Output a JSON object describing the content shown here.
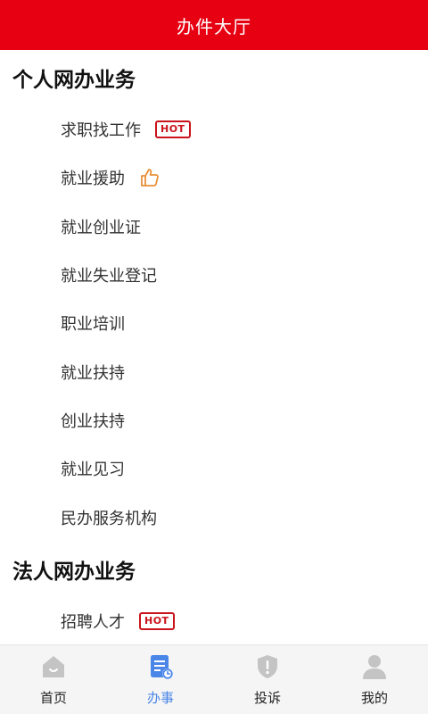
{
  "header": {
    "title": "办件大厅"
  },
  "sections": [
    {
      "title": "个人网办业务",
      "items": [
        {
          "label": "求职找工作",
          "badge": "HOT"
        },
        {
          "label": "就业援助",
          "icon": "thumbs-up-icon"
        },
        {
          "label": "就业创业证"
        },
        {
          "label": "就业失业登记"
        },
        {
          "label": "职业培训"
        },
        {
          "label": "就业扶持"
        },
        {
          "label": "创业扶持"
        },
        {
          "label": "就业见习"
        },
        {
          "label": "民办服务机构"
        }
      ]
    },
    {
      "title": "法人网办业务",
      "items": [
        {
          "label": "招聘人才",
          "badge": "HOT"
        }
      ]
    }
  ],
  "tabbar": {
    "tabs": [
      {
        "label": "首页",
        "icon": "home-icon",
        "active": false
      },
      {
        "label": "办事",
        "icon": "document-clock-icon",
        "active": true
      },
      {
        "label": "投诉",
        "icon": "shield-alert-icon",
        "active": false
      },
      {
        "label": "我的",
        "icon": "user-icon",
        "active": false
      }
    ]
  },
  "colors": {
    "header_bg": "#e60012",
    "hot_badge": "#c9141b",
    "thumb_icon": "#e8903a",
    "tab_active": "#4a86e8",
    "tab_inactive_icon": "#c4c4c4"
  }
}
